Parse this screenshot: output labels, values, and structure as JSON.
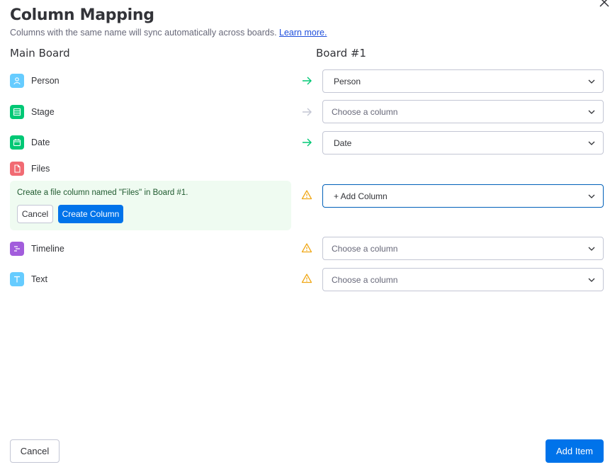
{
  "dialog": {
    "title": "Column Mapping",
    "subtitle": "Columns with the same name will sync automatically across boards.",
    "learn_more": "Learn more."
  },
  "headers": {
    "main": "Main Board",
    "target": "Board #1"
  },
  "columns": [
    {
      "name": "Person",
      "icon": "person-icon",
      "color": "#66ccff",
      "status": "matched",
      "selection": "Person"
    },
    {
      "name": "Stage",
      "icon": "list-icon",
      "color": "#00c875",
      "status": "unmapped",
      "selection": "Choose a column"
    },
    {
      "name": "Date",
      "icon": "calendar-icon",
      "color": "#00c875",
      "status": "matched",
      "selection": "Date"
    },
    {
      "name": "Files",
      "icon": "file-icon",
      "color": "#f16b73",
      "status": "warning",
      "selection": "+ Add Column"
    },
    {
      "name": "Timeline",
      "icon": "timeline-icon",
      "color": "#a25ddc",
      "status": "warning",
      "selection": "Choose a column"
    },
    {
      "name": "Text",
      "icon": "text-icon",
      "color": "#66ccff",
      "status": "warning",
      "selection": "Choose a column"
    }
  ],
  "notice": {
    "text": "Create a file column named \"Files\" in Board #1.",
    "cancel": "Cancel",
    "create": "Create Column"
  },
  "footer": {
    "cancel": "Cancel",
    "add": "Add Item"
  },
  "colors": {
    "primary": "#0073ea",
    "success": "#00c875",
    "warning": "#f0a818",
    "muted": "#c3c6d4"
  }
}
